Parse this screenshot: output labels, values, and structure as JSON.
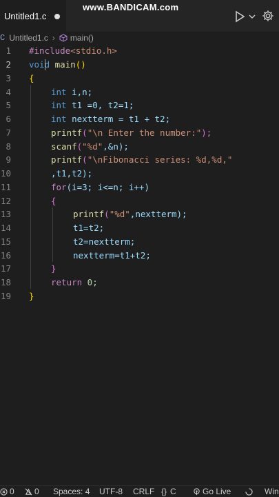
{
  "tab": {
    "label": "Untitled1.c"
  },
  "watermark": "www.BANDICAM.com",
  "breadcrumb": {
    "file": "Untitled1.c",
    "symbol": "main()"
  },
  "code": [
    {
      "n": "1"
    },
    {
      "n": "2"
    },
    {
      "n": "3"
    },
    {
      "n": "4"
    },
    {
      "n": "5"
    },
    {
      "n": "6"
    },
    {
      "n": "7"
    },
    {
      "n": "8"
    },
    {
      "n": "9"
    },
    {
      "n": "10"
    },
    {
      "n": "11"
    },
    {
      "n": "12"
    },
    {
      "n": "13"
    },
    {
      "n": "14"
    },
    {
      "n": "15"
    },
    {
      "n": "16"
    },
    {
      "n": "17"
    },
    {
      "n": "18"
    },
    {
      "n": "19"
    }
  ],
  "tokens": {
    "l1": [
      "#include",
      "<stdio.h>"
    ],
    "l2": [
      "void",
      "main",
      "()"
    ],
    "l3": [
      "{"
    ],
    "l4": [
      "int",
      " i,n;"
    ],
    "l5": [
      "int",
      " t1 =0, t2=1;"
    ],
    "l6": [
      "int",
      " nextterm = t1 + t2;"
    ],
    "l7": [
      "printf",
      "(",
      "\"\\n Enter the number:\"",
      ");"
    ],
    "l8": [
      "scanf",
      "(",
      "\"%d\"",
      ",&n);"
    ],
    "l9": [
      "printf",
      "(",
      "\"\\nFibonacci series: %d,%d,\""
    ],
    "l10": [
      ",t1,t2);"
    ],
    "l11": [
      "for",
      "(i=3; i<=n; i++)"
    ],
    "l12": [
      "{"
    ],
    "l13": [
      "printf",
      "(",
      "\"%d\"",
      ",nextterm);"
    ],
    "l14": [
      "t1=t2;"
    ],
    "l15": [
      "t2=nextterm;"
    ],
    "l16": [
      "nextterm=t1+t2;"
    ],
    "l17": [
      "}"
    ],
    "l18": [
      "return",
      " 0;"
    ],
    "l19": [
      "}"
    ]
  },
  "status": {
    "errors": "0",
    "warnings": "0",
    "spaces": "Spaces: 4",
    "encoding": "UTF-8",
    "eol": "CRLF",
    "lang": "C",
    "golive": "Go Live",
    "win": "Win"
  },
  "colors": {
    "keyword": "#569cd6",
    "function": "#dcdcaa",
    "string": "#ce9178",
    "variable": "#9cdcfe",
    "bracket": "#ffd700",
    "number": "#b5cea8"
  }
}
